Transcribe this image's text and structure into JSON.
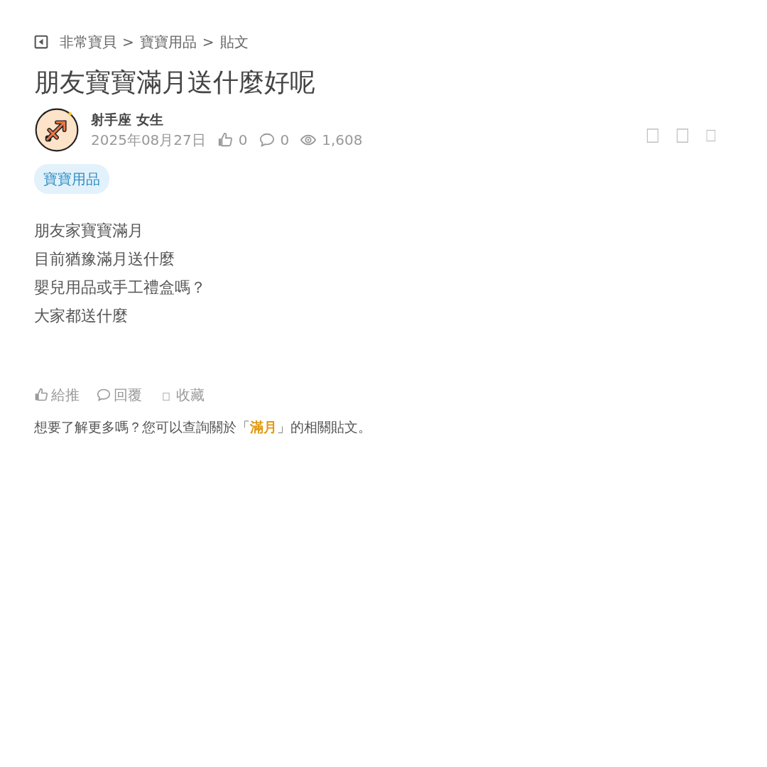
{
  "breadcrumb": {
    "items": [
      "非常寶貝",
      "寶寶用品",
      "貼文"
    ],
    "separators": [
      ">",
      ">"
    ]
  },
  "post": {
    "title": "朋友寶寶滿月送什麼好呢",
    "author": "射手座 女生",
    "date": "2025年08月27日",
    "stats": [
      {
        "kind": "like",
        "value": "0"
      },
      {
        "kind": "comment",
        "value": "0"
      },
      {
        "kind": "view",
        "value": "1,608"
      }
    ],
    "tag": "寶寶用品",
    "body": [
      "朋友家寶寶滿月",
      "目前猶豫滿月送什麼",
      "嬰兒用品或手工禮盒嗎？",
      "大家都送什麼"
    ],
    "actions": [
      {
        "kind": "like",
        "label": "給推"
      },
      {
        "kind": "reply",
        "label": "回覆"
      },
      {
        "kind": "save",
        "label": "收藏"
      }
    ],
    "related": {
      "prefix": "想要了解更多嗎？您可以查詢關於「",
      "keyword": "滿月",
      "suffix": "」的相關貼文。"
    }
  }
}
